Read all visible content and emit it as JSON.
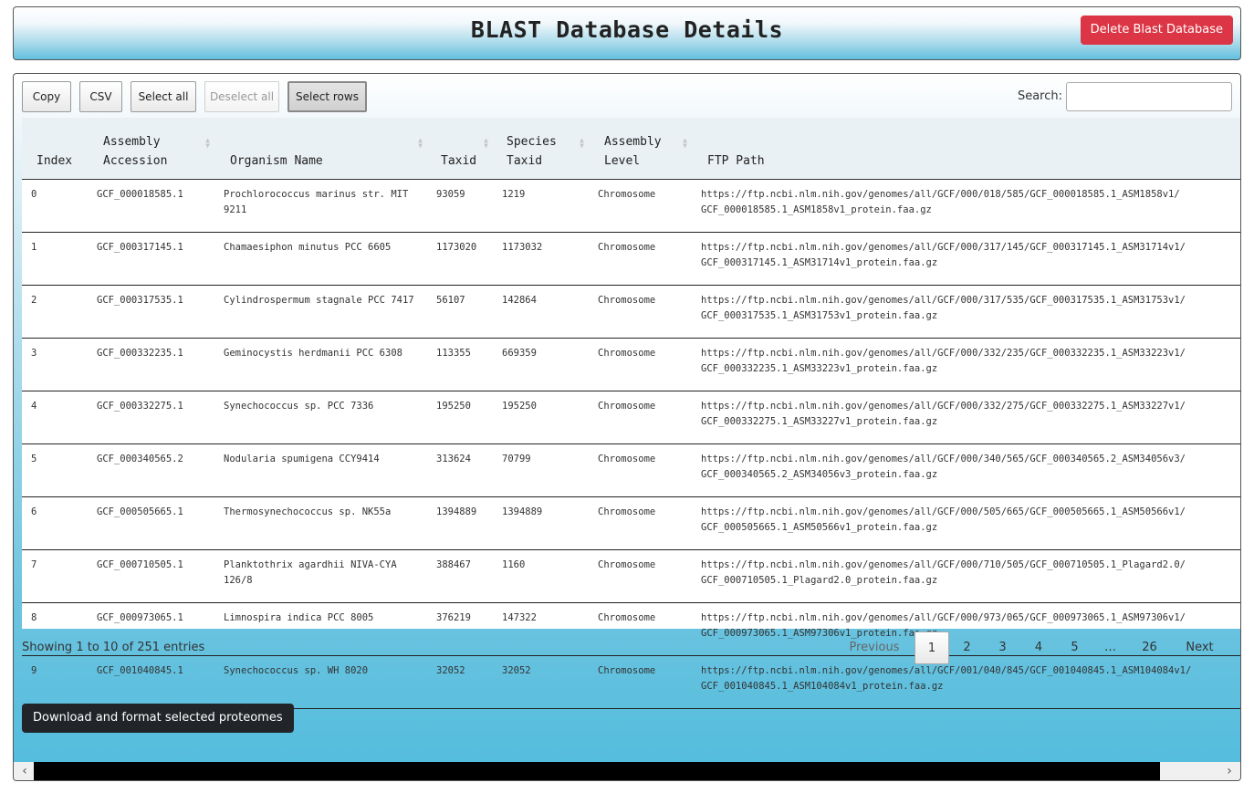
{
  "header": {
    "title": "BLAST Database Details",
    "delete_label": "Delete Blast Database"
  },
  "toolbar": {
    "buttons": [
      {
        "label": "Copy",
        "state": "normal"
      },
      {
        "label": "CSV",
        "state": "normal"
      },
      {
        "label": "Select all",
        "state": "normal"
      },
      {
        "label": "Deselect all",
        "state": "disabled"
      },
      {
        "label": "Select rows",
        "state": "active"
      }
    ],
    "search_label": "Search:",
    "search_value": ""
  },
  "table": {
    "columns": [
      {
        "label": "Index",
        "sort": "asc"
      },
      {
        "label": "Assembly Accession",
        "sort": "none"
      },
      {
        "label": "Organism Name",
        "sort": "none"
      },
      {
        "label": "Taxid",
        "sort": "none"
      },
      {
        "label": "Species Taxid",
        "sort": "none"
      },
      {
        "label": "Assembly Level",
        "sort": "none"
      },
      {
        "label": "FTP Path",
        "sort": "none"
      }
    ],
    "rows": [
      [
        "0",
        "GCF_000018585.1",
        "Prochlorococcus marinus str. MIT 9211",
        "93059",
        "1219",
        "Chromosome",
        "https://ftp.ncbi.nlm.nih.gov/genomes/all/GCF/000/018/585/GCF_000018585.1_ASM1858v1/",
        "GCF_000018585.1_ASM1858v1_protein.faa.gz"
      ],
      [
        "1",
        "GCF_000317145.1",
        "Chamaesiphon minutus PCC 6605",
        "1173020",
        "1173032",
        "Chromosome",
        "https://ftp.ncbi.nlm.nih.gov/genomes/all/GCF/000/317/145/GCF_000317145.1_ASM31714v1/",
        "GCF_000317145.1_ASM31714v1_protein.faa.gz"
      ],
      [
        "2",
        "GCF_000317535.1",
        "Cylindrospermum stagnale PCC 7417",
        "56107",
        "142864",
        "Chromosome",
        "https://ftp.ncbi.nlm.nih.gov/genomes/all/GCF/000/317/535/GCF_000317535.1_ASM31753v1/",
        "GCF_000317535.1_ASM31753v1_protein.faa.gz"
      ],
      [
        "3",
        "GCF_000332235.1",
        "Geminocystis herdmanii PCC 6308",
        "113355",
        "669359",
        "Chromosome",
        "https://ftp.ncbi.nlm.nih.gov/genomes/all/GCF/000/332/235/GCF_000332235.1_ASM33223v1/",
        "GCF_000332235.1_ASM33223v1_protein.faa.gz"
      ],
      [
        "4",
        "GCF_000332275.1",
        "Synechococcus sp. PCC 7336",
        "195250",
        "195250",
        "Chromosome",
        "https://ftp.ncbi.nlm.nih.gov/genomes/all/GCF/000/332/275/GCF_000332275.1_ASM33227v1/",
        "GCF_000332275.1_ASM33227v1_protein.faa.gz"
      ],
      [
        "5",
        "GCF_000340565.2",
        "Nodularia spumigena CCY9414",
        "313624",
        "70799",
        "Chromosome",
        "https://ftp.ncbi.nlm.nih.gov/genomes/all/GCF/000/340/565/GCF_000340565.2_ASM34056v3/",
        "GCF_000340565.2_ASM34056v3_protein.faa.gz"
      ],
      [
        "6",
        "GCF_000505665.1",
        "Thermosynechococcus sp. NK55a",
        "1394889",
        "1394889",
        "Chromosome",
        "https://ftp.ncbi.nlm.nih.gov/genomes/all/GCF/000/505/665/GCF_000505665.1_ASM50566v1/",
        "GCF_000505665.1_ASM50566v1_protein.faa.gz"
      ],
      [
        "7",
        "GCF_000710505.1",
        "Planktothrix agardhii NIVA-CYA 126/8",
        "388467",
        "1160",
        "Chromosome",
        "https://ftp.ncbi.nlm.nih.gov/genomes/all/GCF/000/710/505/GCF_000710505.1_Plagard2.0/",
        "GCF_000710505.1_Plagard2.0_protein.faa.gz"
      ],
      [
        "8",
        "GCF_000973065.1",
        "Limnospira indica PCC 8005",
        "376219",
        "147322",
        "Chromosome",
        "https://ftp.ncbi.nlm.nih.gov/genomes/all/GCF/000/973/065/GCF_000973065.1_ASM97306v1/",
        "GCF_000973065.1_ASM97306v1_protein.faa.gz"
      ],
      [
        "9",
        "GCF_001040845.1",
        "Synechococcus sp. WH 8020",
        "32052",
        "32052",
        "Chromosome",
        "https://ftp.ncbi.nlm.nih.gov/genomes/all/GCF/001/040/845/GCF_001040845.1_ASM104084v1/",
        "GCF_001040845.1_ASM104084v1_protein.faa.gz"
      ]
    ]
  },
  "footer": {
    "info": "Showing 1 to 10 of 251 entries",
    "pagination": [
      {
        "label": "Previous",
        "state": "disabled"
      },
      {
        "label": "1",
        "state": "current"
      },
      {
        "label": "2",
        "state": "normal"
      },
      {
        "label": "3",
        "state": "normal"
      },
      {
        "label": "4",
        "state": "normal"
      },
      {
        "label": "5",
        "state": "normal"
      },
      {
        "label": "…",
        "state": "ellipsis"
      },
      {
        "label": "26",
        "state": "normal"
      },
      {
        "label": "Next",
        "state": "normal"
      }
    ],
    "download_label": "Download and format selected proteomes"
  },
  "scrollbar": {
    "left_icon": "chevron-left-icon",
    "right_icon": "chevron-right-icon"
  },
  "colors": {
    "delete": "#dc3545",
    "download": "#212529",
    "panel_blue": "#52bcdd",
    "sort_active": "#6680cc"
  }
}
